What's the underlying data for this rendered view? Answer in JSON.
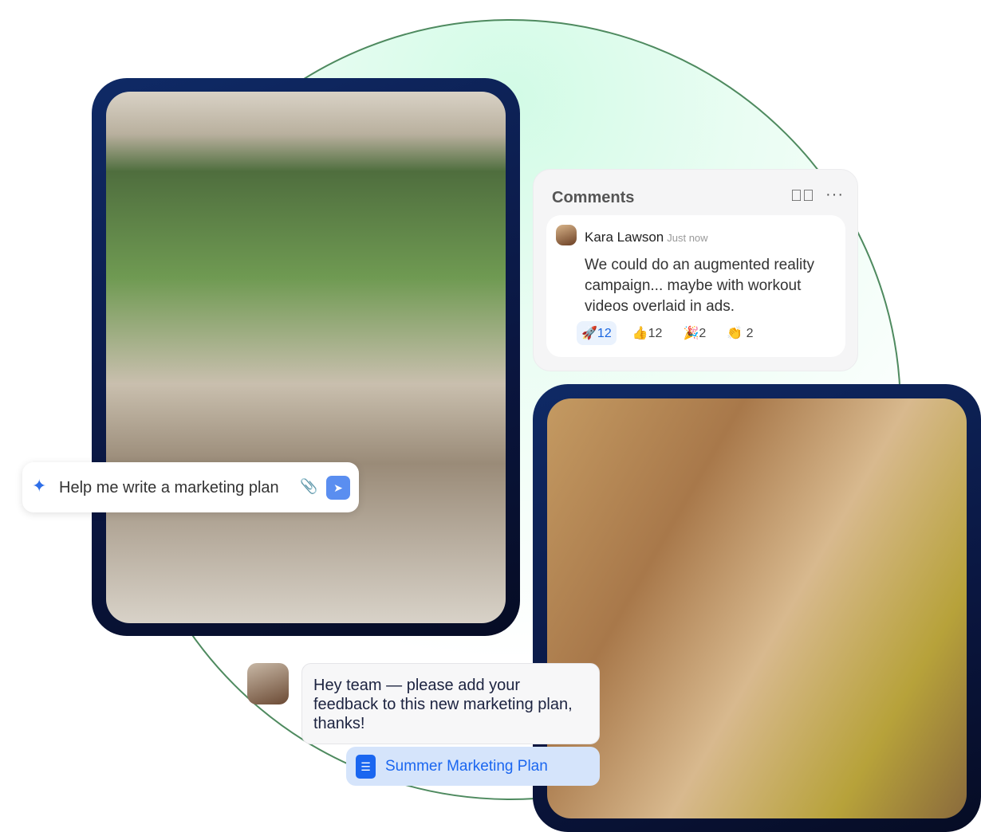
{
  "prompt": {
    "text": "Help me write a marketing plan",
    "sparkle_icon": "sparkle-icon",
    "attach_icon": "paperclip-icon",
    "send_icon": "send-icon",
    "accent": "#5a8ef0"
  },
  "comments": {
    "title": "Comments",
    "author": "Kara Lawson",
    "time": "Just now",
    "text": "We could do an augmented reality campaign... maybe with workout videos overlaid in ads.",
    "reactions": [
      {
        "emoji": "🚀",
        "count": "12",
        "active": true
      },
      {
        "emoji": "👍",
        "count": "12"
      },
      {
        "emoji": "🎉",
        "count": "2"
      },
      {
        "emoji": "👏",
        "count": "2"
      }
    ]
  },
  "message": {
    "text": "Hey team — please add your feedback to this new marketing plan, thanks!",
    "attachment": "Summer Marketing Plan",
    "accent": "#1a66f0"
  }
}
